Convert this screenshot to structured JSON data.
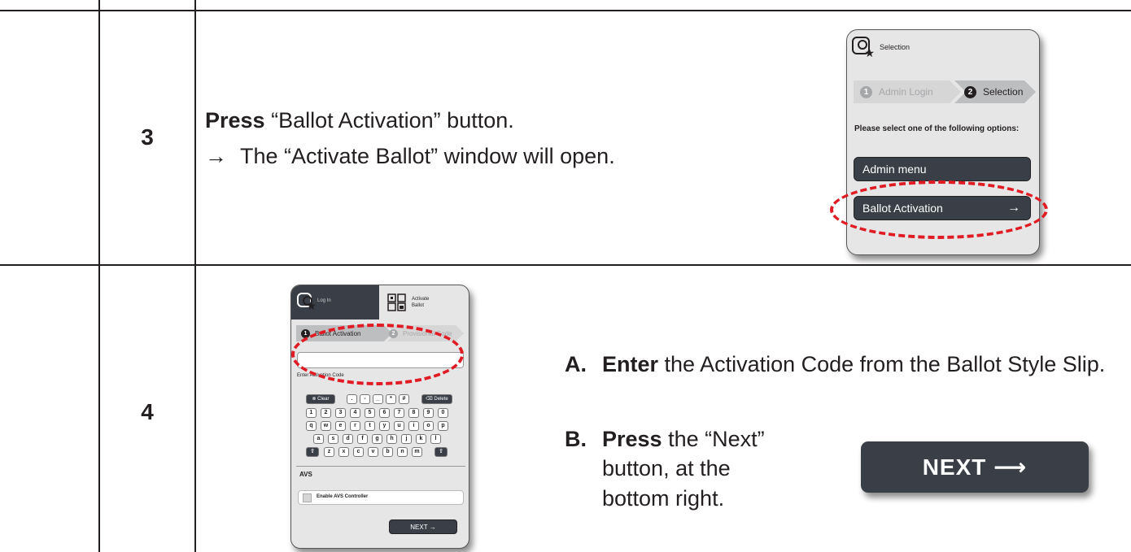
{
  "steps": [
    {
      "number": "3",
      "line1_bold": "Press",
      "line1_rest": " “Ballot Activation” button.",
      "line2_arrow": "→",
      "line2_text": "The “Activate Ballot” window will open."
    },
    {
      "number": "4",
      "a_letter": "A.",
      "a_bold": "Enter",
      "a_rest": " the Activation Code from the Ballot Style Slip.",
      "b_letter": "B.",
      "b_bold": "Press",
      "b_rest": " the “Next” button, at the bottom right."
    }
  ],
  "screen1": {
    "title": "Selection",
    "crumb1_num": "1",
    "crumb1_label": "Admin Login",
    "crumb2_num": "2",
    "crumb2_label": "Selection",
    "prompt": "Please select one of the following options:",
    "admin_menu": "Admin menu",
    "ballot_activation": "Ballot Activation",
    "arrow": "→"
  },
  "screen2": {
    "tab_login": "Log In",
    "tab_activate_1": "Activate",
    "tab_activate_2": "Ballot",
    "crumb1_num": "1",
    "crumb1_label": "Ballot Activation",
    "crumb2_num": "2",
    "crumb2_label": "Provisional Code",
    "input_label": "Enter Activation Code",
    "clear": "Clear",
    "delete": "Delete",
    "sym_keys": [
      ".",
      "-",
      "_",
      "*",
      "#"
    ],
    "row_digits": [
      "1",
      "2",
      "3",
      "4",
      "5",
      "6",
      "7",
      "8",
      "9",
      "0"
    ],
    "row_q": [
      "q",
      "w",
      "e",
      "r",
      "t",
      "y",
      "u",
      "i",
      "o",
      "p"
    ],
    "row_a": [
      "a",
      "s",
      "d",
      "f",
      "g",
      "h",
      "j",
      "k",
      "l"
    ],
    "row_z": [
      "z",
      "x",
      "c",
      "v",
      "b",
      "n",
      "m"
    ],
    "shift": "⇧",
    "avs_heading": "AVS",
    "avs_checkbox": "Enable AVS Controller",
    "next": "NEXT →"
  },
  "next_button": "NEXT ⟶"
}
